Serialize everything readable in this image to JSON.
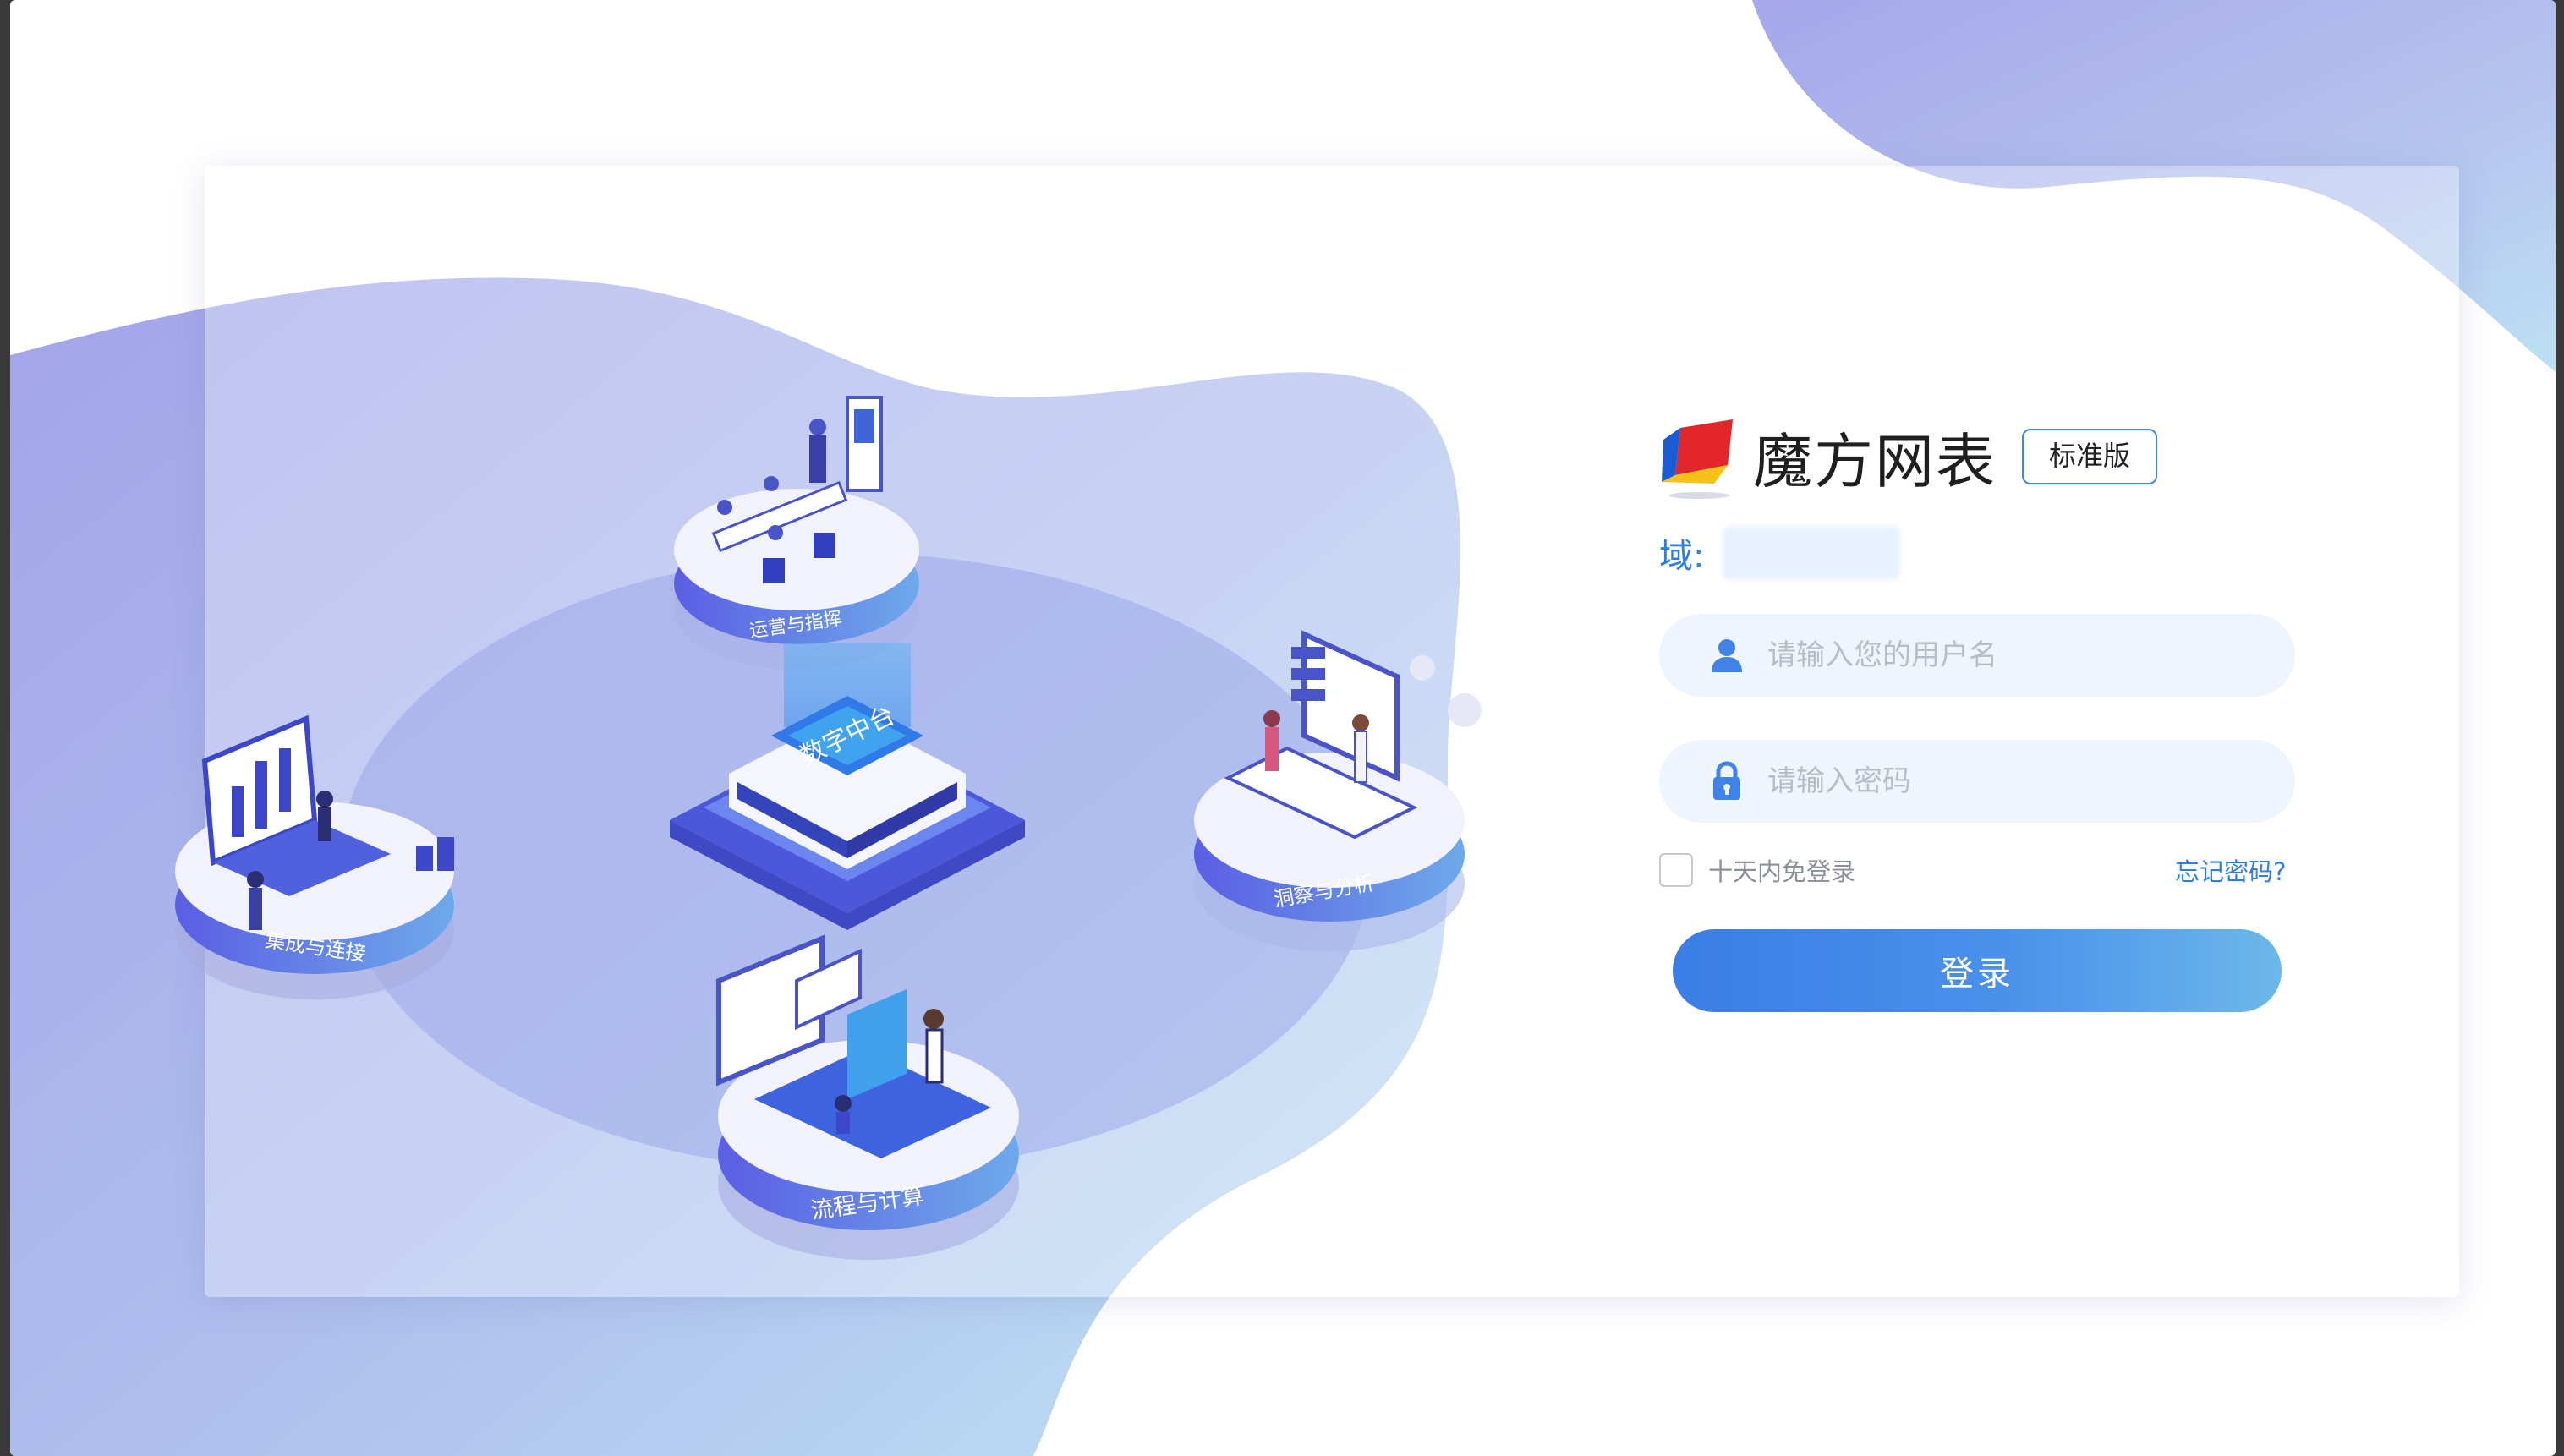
{
  "brand": {
    "name": "魔方网表",
    "edition": "标准版",
    "colors": {
      "accent": "#2f7ee6",
      "button_start": "#3a7ee6",
      "button_end": "#6cb8ea",
      "blob_start": "#a3a6e9",
      "blob_end": "#b8e0f2"
    }
  },
  "domain": {
    "label": "域:",
    "value": ""
  },
  "username": {
    "placeholder": "请输入您的用户名",
    "value": "",
    "icon": "user-icon"
  },
  "password": {
    "placeholder": "请输入密码",
    "value": "",
    "icon": "lock-icon"
  },
  "remember": {
    "label": "十天内免登录",
    "checked": false
  },
  "forgot_label": "忘记密码?",
  "login_label": "登录",
  "illustration": {
    "center": "数字中台",
    "nodes": [
      "运营与指挥",
      "集成与连接",
      "洞察与分析",
      "流程与计算"
    ]
  }
}
